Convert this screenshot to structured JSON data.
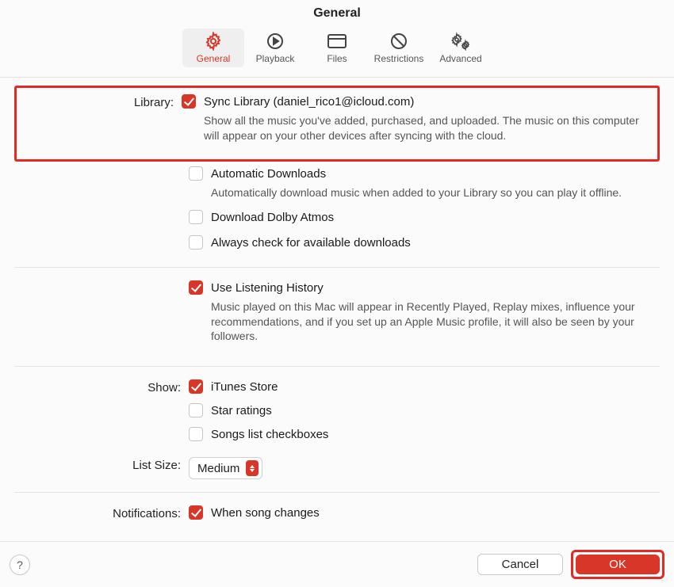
{
  "title": "General",
  "toolbar": {
    "general": "General",
    "playback": "Playback",
    "files": "Files",
    "restrictions": "Restrictions",
    "advanced": "Advanced"
  },
  "labels": {
    "library": "Library:",
    "show": "Show:",
    "list_size": "List Size:",
    "notifications": "Notifications:"
  },
  "options": {
    "sync_library": "Sync Library (daniel_rico1@icloud.com)",
    "sync_library_desc": "Show all the music you've added, purchased, and uploaded. The music on this computer will appear on your other devices after syncing with the cloud.",
    "auto_downloads": "Automatic Downloads",
    "auto_downloads_desc": "Automatically download music when added to your Library so you can play it offline.",
    "dolby": "Download Dolby Atmos",
    "check_downloads": "Always check for available downloads",
    "listening_history": "Use Listening History",
    "listening_history_desc": "Music played on this Mac will appear in Recently Played, Replay mixes, influence your recommendations, and if you set up an Apple Music profile, it will also be seen by your followers.",
    "itunes_store": "iTunes Store",
    "star_ratings": "Star ratings",
    "songs_checkboxes": "Songs list checkboxes",
    "list_size_value": "Medium",
    "song_changes": "When song changes"
  },
  "footer": {
    "cancel": "Cancel",
    "ok": "OK"
  }
}
